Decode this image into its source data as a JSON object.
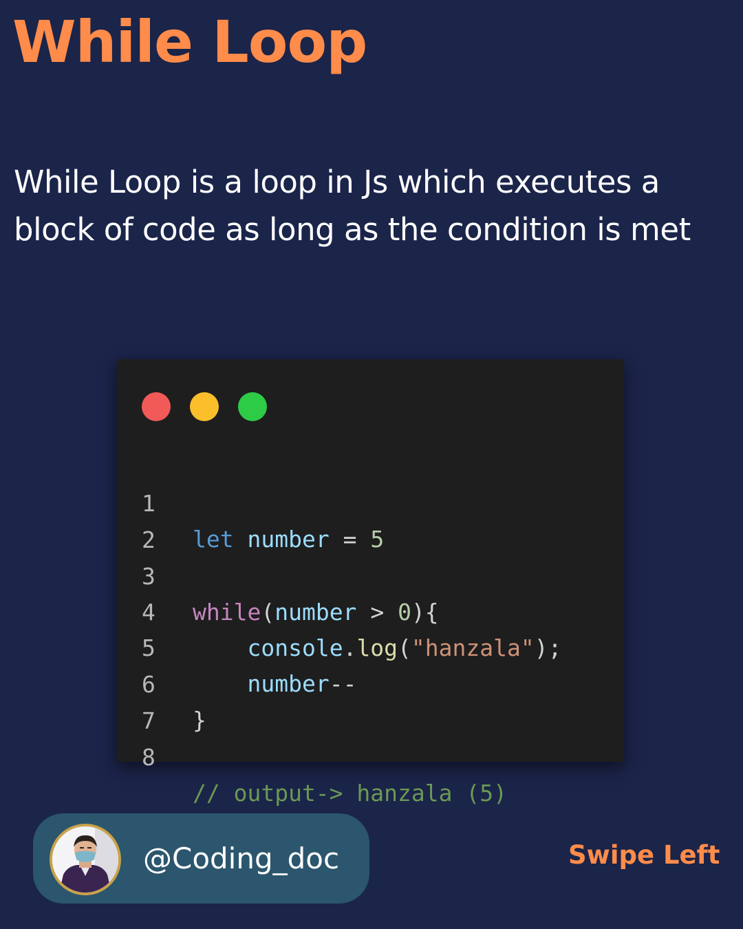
{
  "title": "While Loop",
  "description": "While Loop is a loop in Js which executes a block of code as long as the condition is met",
  "code": {
    "line_numbers": [
      "1",
      "2",
      "3",
      "4",
      "5",
      "6",
      "7",
      "8"
    ],
    "tokens": {
      "l1_kw": "let",
      "l1_var": "number",
      "l1_op": "=",
      "l1_num": "5",
      "l3_kw": "while",
      "l3_paren": "(",
      "l3_var": "number",
      "l3_op": ">",
      "l3_num": "0",
      "l3_close": "){",
      "l4_obj": "console",
      "l4_dot": ".",
      "l4_fn": "log",
      "l4_open": "(",
      "l4_str": "\"hanzala\"",
      "l4_close": ");",
      "l5_var": "number",
      "l5_op": "--",
      "l6_brace": "}",
      "l8_comment": "// output-> hanzala (5)"
    }
  },
  "footer": {
    "handle": "@Coding_doc",
    "swipe_label": "Swipe Left"
  },
  "colors": {
    "background": "#1b2449",
    "accent": "#ff8c4a",
    "code_bg": "#1e1e1e",
    "badge_bg": "#2b566d",
    "dot_red": "#f25a57",
    "dot_yellow": "#fbbf2c",
    "dot_green": "#2ecb47",
    "keyword_blue": "#569cd6",
    "keyword_purple": "#c586c0",
    "variable": "#9cdcfe",
    "number": "#b5cea8",
    "string": "#ce9178",
    "function": "#dcdcaa",
    "comment": "#6a9955",
    "punctuation": "#d4d4d4"
  },
  "icons": [
    "window-close-dot-icon",
    "window-minimize-dot-icon",
    "window-maximize-dot-icon",
    "avatar-icon"
  ]
}
